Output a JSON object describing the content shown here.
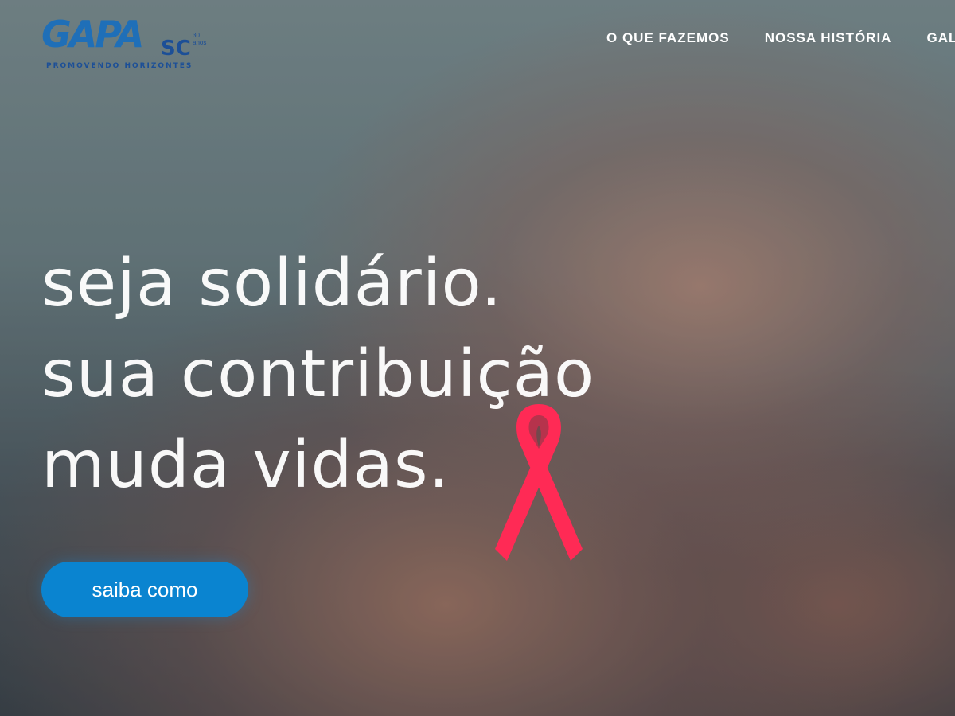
{
  "brand": {
    "logo_text": "GAPA",
    "logo_suffix": "SC",
    "logo_badge": "30 anos",
    "tagline": "PROMOVENDO HORIZONTES"
  },
  "nav": {
    "items": [
      {
        "label": "O QUE FAZEMOS"
      },
      {
        "label": "NOSSA HISTÓRIA"
      },
      {
        "label": "GALE"
      }
    ]
  },
  "hero": {
    "headline_lines": [
      "seja solidário.",
      "sua contribuição",
      "muda vidas."
    ],
    "cta_label": "saiba como"
  },
  "colors": {
    "cta_background": "#0a84d0",
    "ribbon": "#ff2a55",
    "logo_blue": "#1f6fb8"
  }
}
